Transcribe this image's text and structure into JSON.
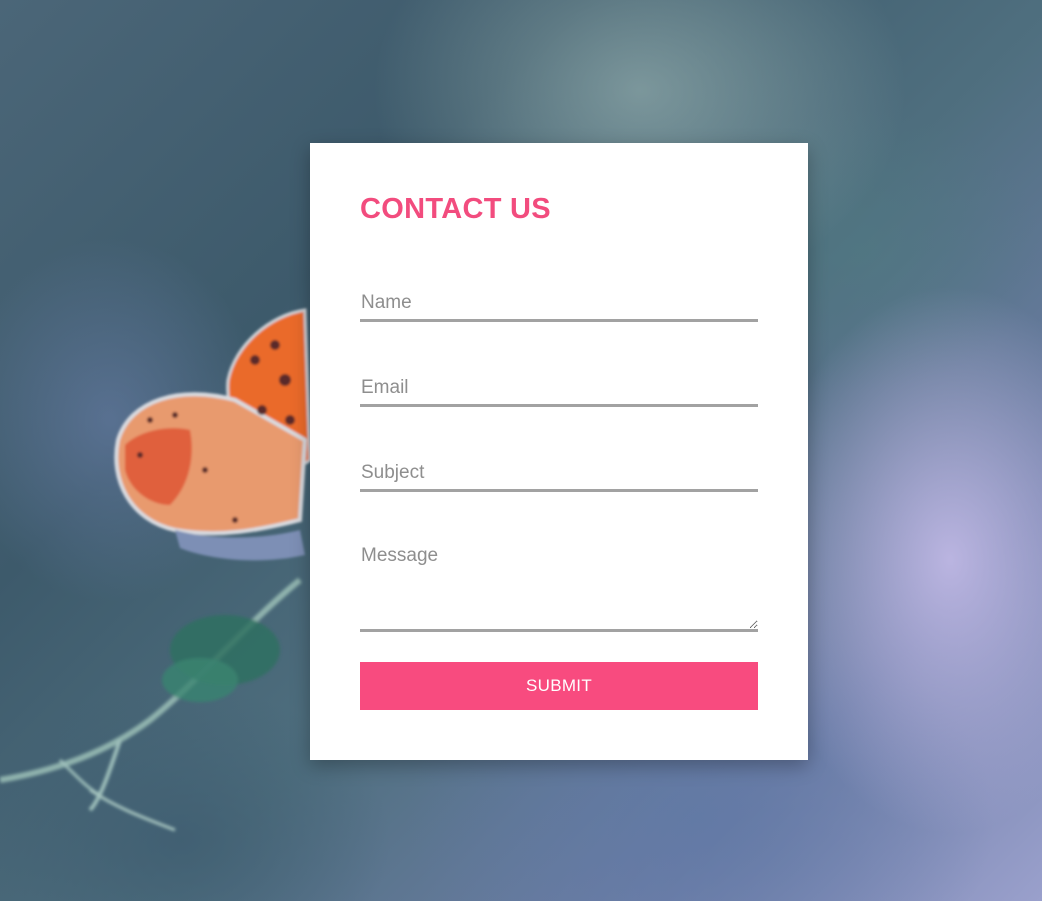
{
  "form": {
    "title": "CONTACT US",
    "name_placeholder": "Name",
    "email_placeholder": "Email",
    "subject_placeholder": "Subject",
    "message_placeholder": "Message",
    "submit_label": "SUBMIT"
  },
  "colors": {
    "accent": "#f84b7f",
    "title": "#f24c7e",
    "field_underline": "#a2a2a2",
    "placeholder": "#8e8e8e",
    "card_background": "#ffffff"
  }
}
